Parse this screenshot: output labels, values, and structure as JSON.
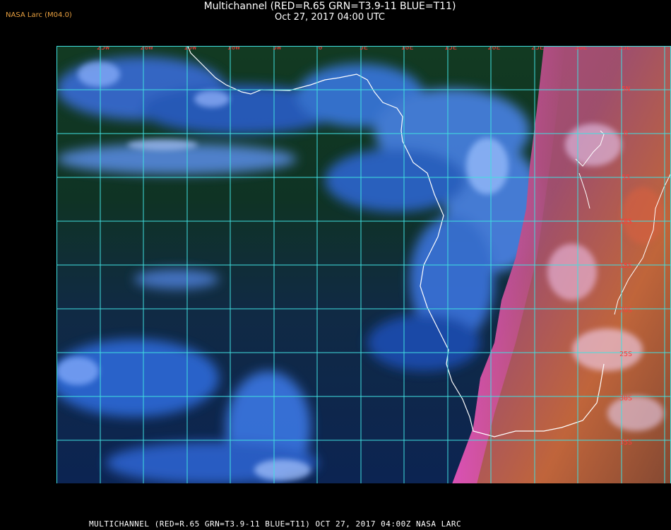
{
  "header": {
    "source_label": "NASA Larc (M04.0)",
    "title": "Multichannel (RED=R.65 GRN=T3.9-11 BLUE=T11)",
    "subtitle": "Oct 27, 2017 04:00 UTC"
  },
  "map": {
    "region": "South-West Africa and South Atlantic",
    "grid_color": "#40e0e0",
    "coastline_color": "#ffffff",
    "label_color": "#ff3b3b",
    "longitude_labels": [
      "25W",
      "20W",
      "15W",
      "10W",
      "5W",
      "0",
      "5E",
      "10E",
      "15E",
      "20E",
      "25E",
      "30E",
      "35E"
    ],
    "latitude_labels": [
      "5N",
      "0",
      "5S",
      "10S",
      "15S",
      "20S",
      "25S",
      "30S",
      "35S",
      "40S"
    ]
  },
  "footer": {
    "text": "MULTICHANNEL (RED=R.65 GRN=T3.9-11 BLUE=T11) OCT 27, 2017 04:00Z   NASA LARC"
  }
}
